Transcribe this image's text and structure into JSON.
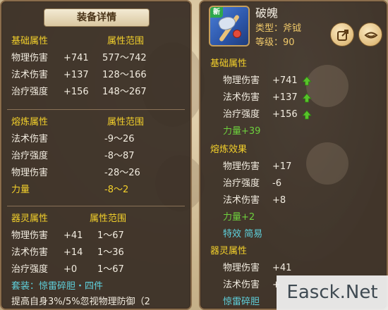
{
  "left_panel": {
    "title": "装备详情",
    "basic": {
      "header_attr": "基础属性",
      "header_range": "属性范围",
      "rows": [
        {
          "name": "物理伤害",
          "value": "+741",
          "range": "577～742"
        },
        {
          "name": "法术伤害",
          "value": "+137",
          "range": "128～166"
        },
        {
          "name": "治疗强度",
          "value": "+156",
          "range": "148～267"
        }
      ]
    },
    "refine": {
      "header_attr": "熔炼属性",
      "header_range": "属性范围",
      "rows": [
        {
          "name": "法术伤害",
          "range": "-9～26"
        },
        {
          "name": "治疗强度",
          "range": "-8～87"
        },
        {
          "name": "物理伤害",
          "range": "-28～26"
        }
      ],
      "special": {
        "name": "力量",
        "range": "-8～2"
      }
    },
    "spirit": {
      "header_attr": "器灵属性",
      "header_range": "属性范围",
      "rows": [
        {
          "name": "物理伤害",
          "value": "+41",
          "range": "1～67"
        },
        {
          "name": "法术伤害",
          "value": "+14",
          "range": "1～36"
        },
        {
          "name": "治疗强度",
          "value": "+0",
          "range": "1～67"
        }
      ],
      "set_line": "套装：惊雷碎胆・四件",
      "set_desc": "提高自身3%/5%忽视物理防御（2"
    }
  },
  "right_panel": {
    "badge": "新",
    "item_name": "破魄",
    "type_line": "类型：斧钺",
    "level_line": "等级：90",
    "buttons": {
      "share_icon": "share-icon",
      "eye_icon": "eye-icon"
    },
    "basic": {
      "header": "基础属性",
      "rows": [
        {
          "name": "物理伤害",
          "value": "+741"
        },
        {
          "name": "法术伤害",
          "value": "+137"
        },
        {
          "name": "治疗强度",
          "value": "+156"
        }
      ],
      "bonus": "力量+39"
    },
    "refine": {
      "header": "熔炼效果",
      "rows": [
        {
          "name": "物理伤害",
          "value": "+17"
        },
        {
          "name": "治疗强度",
          "value": "-6"
        },
        {
          "name": "法术伤害",
          "value": "+8"
        }
      ],
      "bonus": "力量+2",
      "effect": "特效  简易"
    },
    "spirit": {
      "header": "器灵属性",
      "rows": [
        {
          "name": "物理伤害",
          "value": "+41"
        },
        {
          "name": "法术伤害",
          "value": "+"
        }
      ],
      "set_line": "惊雷碎胆"
    }
  },
  "watermark": "Easck.Net",
  "colors": {
    "header_yellow": "#f3d02b",
    "value_white": "#f2ece0",
    "bonus_green": "#6ed03d",
    "effect_cyan": "#5fd3df",
    "panel_bg": "#372c24",
    "panel_border": "#8a6d4c"
  }
}
